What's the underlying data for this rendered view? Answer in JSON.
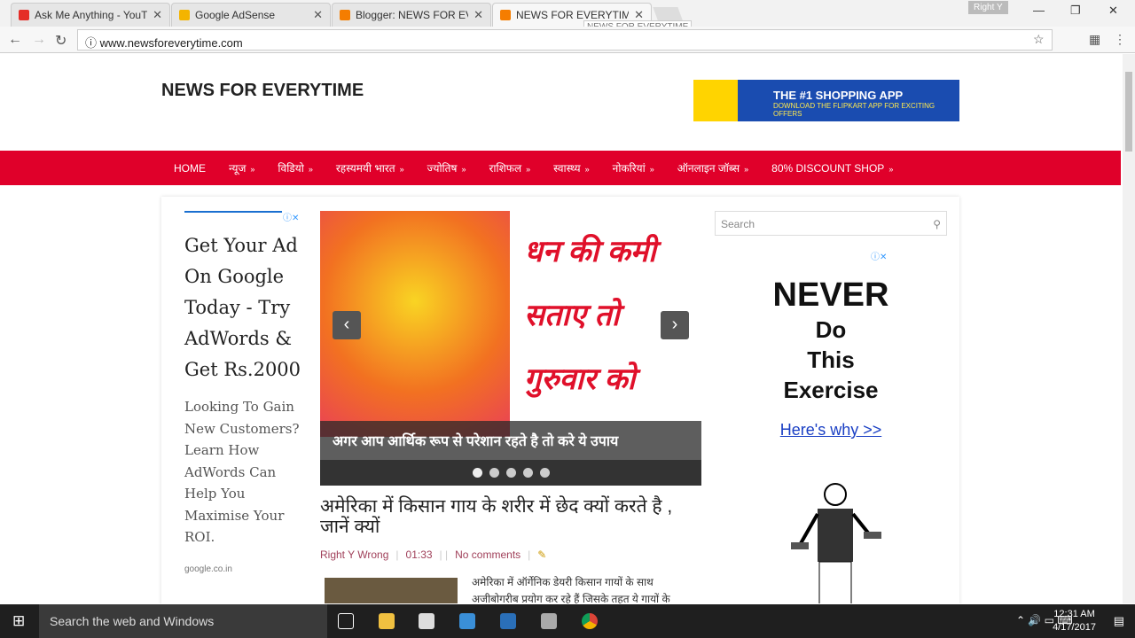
{
  "browser": {
    "tabs": [
      {
        "title": "Ask Me Anything - YouTube",
        "color": "#e52d27"
      },
      {
        "title": "Google AdSense",
        "color": "#f4b400"
      },
      {
        "title": "Blogger: NEWS FOR EVERYTIME",
        "color": "#f57d00"
      },
      {
        "title": "NEWS FOR EVERYTIME",
        "color": "#f57d00"
      }
    ],
    "tooltip": "NEWS FOR EVERYTIME",
    "profile": "Right Y",
    "url": "www.newsforeverytime.com"
  },
  "site": {
    "title": "NEWS FOR EVERYTIME",
    "banner": {
      "headline": "THE #1 SHOPPING APP",
      "sub": "DOWNLOAD THE FLIPKART APP FOR EXCITING OFFERS"
    },
    "menu": [
      "HOME",
      "न्यूज",
      "विडियो",
      "रहस्यमयी भारत",
      "ज्योतिष",
      "राशिफल",
      "स्वास्थ्य",
      "नोकरियां",
      "ऑनलाइन जॉब्स",
      "80% DISCOUNT SHOP"
    ],
    "left_ad": {
      "headline": "Get Your Ad On Google Today - Try AdWords & Get Rs.2000",
      "body": "Looking To Gain New Customers? Learn How AdWords Can Help You Maximise Your ROI.",
      "source": "google.co.in"
    },
    "slider": {
      "image_text": "धन की कमी सताए तो गुरुवार को",
      "caption": "अगर आप आर्थिक रूप से परेशान रहते है तो करे ये उपाय",
      "slides": 5
    },
    "post": {
      "title": "अमेरिका में किसान गाय के शरीर में छेद क्यों करते है , जानें क्यों",
      "author": "Right Y Wrong",
      "time": "01:33",
      "comments": "No comments",
      "excerpt": "अमेरिका में ऑर्गेनिक डेयरी किसान गायों के साथ अजीबोगरीब प्रयोग कर रहे हैं जिसके तहत ये गायों के"
    },
    "search_placeholder": "Search",
    "right_ad": {
      "line1": "NEVER",
      "line2": "Do",
      "line3": "This",
      "line4": "Exercise",
      "link": "Here's why >>"
    }
  },
  "taskbar": {
    "search": "Search the web and Windows",
    "time": "12:31 AM",
    "date": "4/17/2017"
  }
}
